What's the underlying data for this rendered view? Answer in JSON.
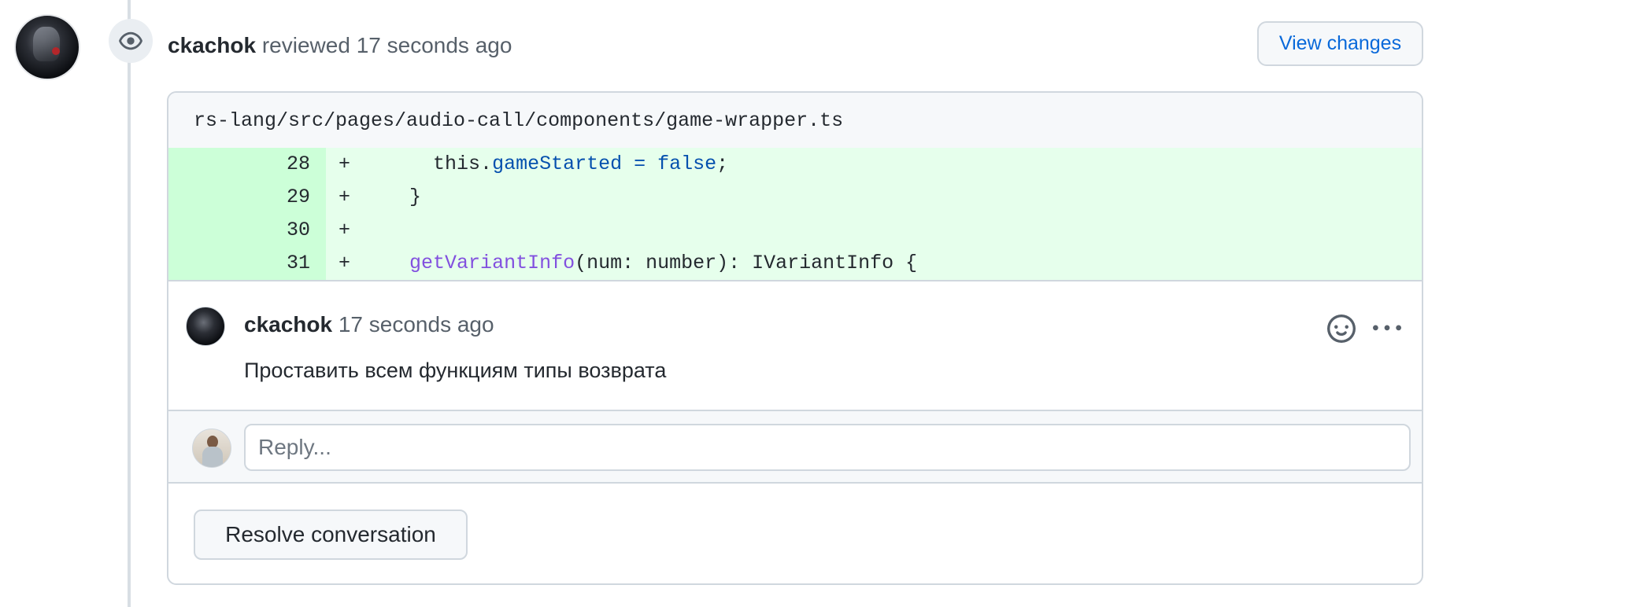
{
  "review": {
    "author": "ckachok",
    "action": "reviewed",
    "time": "17 seconds ago",
    "view_changes_label": "View changes"
  },
  "file": {
    "path": "rs-lang/src/pages/audio-call/components/game-wrapper.ts"
  },
  "diff": {
    "lines": [
      {
        "num": "28",
        "sign": "+",
        "indent": "    ",
        "plain_before": "this.",
        "prop": "gameStarted = false",
        "plain_after": ";"
      },
      {
        "num": "29",
        "sign": "+",
        "indent": "  ",
        "plain": "}"
      },
      {
        "num": "30",
        "sign": "+",
        "indent": "",
        "plain": ""
      },
      {
        "num": "31",
        "sign": "+",
        "indent": "  ",
        "fn": "getVariantInfo",
        "plain_after": "(num: number): IVariantInfo {"
      }
    ]
  },
  "comment": {
    "author": "ckachok",
    "time": "17 seconds ago",
    "body": "Проставить всем функциям типы возврата"
  },
  "reply": {
    "placeholder": "Reply..."
  },
  "resolve_label": "Resolve conversation",
  "icons": {
    "eye": "eye-icon",
    "smiley": "smiley-icon",
    "kebab": "kebab-horizontal-icon"
  }
}
